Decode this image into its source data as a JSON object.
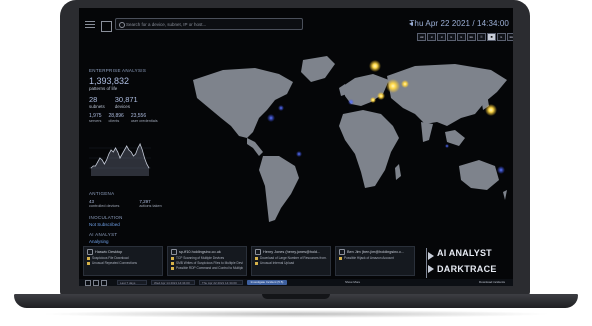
{
  "topbar": {
    "search_placeholder": "Search for a device, subnet, IP or host...",
    "datetime": "Thu Apr 22 2021 / 14:34:00",
    "time_buttons": [
      "◂◂",
      "◂",
      "◂",
      "▸",
      "▸",
      "▸▸",
      "II",
      "■",
      "▸",
      "▸▸",
      "▸▸▸",
      "⟲"
    ]
  },
  "panel": {
    "title": "ENTERPRISE ANALYSIS",
    "patterns_value": "1,393,832",
    "patterns_label": "patterns of life",
    "subnets_value": "28",
    "subnets_label": "subnets",
    "devices_value": "30,871",
    "devices_label": "devices",
    "servers_value": "1,975",
    "servers_label": "servers",
    "clients_value": "28,896",
    "clients_label": "clients",
    "credentials_value": "23,556",
    "credentials_label": "user credentials"
  },
  "antigena": {
    "title": "ANTIGENA",
    "controlled_value": "43",
    "controlled_label": "controlled devices",
    "actions_value": "7,297",
    "actions_label": "actions taken"
  },
  "inoculation": {
    "title": "INOCULATION",
    "status": "Not Subscribed"
  },
  "ai_analyst": {
    "title": "AI ANALYST",
    "status": "Analysing"
  },
  "cards": [
    {
      "header": "Haswic Desktop",
      "lines": [
        "Suspicious File Download",
        "Unusual Repeated Connections"
      ]
    },
    {
      "header": "sp-ff10.holdingsinc.co.uk",
      "lines": [
        "TCP Scanning of Multiple Devices",
        "SMB Writes of Suspicious Files to Multiple Devi...",
        "Possible RDP Command and Control to Multiple..."
      ]
    },
    {
      "header": "Henry Jones (henry.jones@hold...",
      "lines": [
        "Download of Large Number of Resources from...",
        "Unusual Internal Upload"
      ]
    },
    {
      "header": "Ben Jim (ben.jim@holdingsinc.c...",
      "lines": [
        "Possible Hijack of Amazon Account"
      ]
    }
  ],
  "brand": {
    "ai_analyst": "AI ANALYST",
    "darktrace": "DARKTRACE"
  },
  "bottombar": {
    "range": "Last 7 days",
    "from": "Wed Apr 14 2021 14:34:00",
    "to": "Thu Apr 22 2021 14:34:00",
    "apply_label": "Investigate Incident (5.5)",
    "show_more": "Show More",
    "download": "Download incidents"
  },
  "chart_data": {
    "type": "area",
    "values": [
      4,
      5,
      5,
      7,
      9,
      8,
      6,
      8,
      11,
      13,
      12,
      14,
      12,
      9,
      11,
      13,
      15,
      13,
      12,
      10,
      11,
      14,
      16,
      13,
      9,
      6,
      4
    ]
  },
  "colors": {
    "accent": "#6fa0e8",
    "hotspot": "#ffd94a",
    "background": "#050608"
  }
}
